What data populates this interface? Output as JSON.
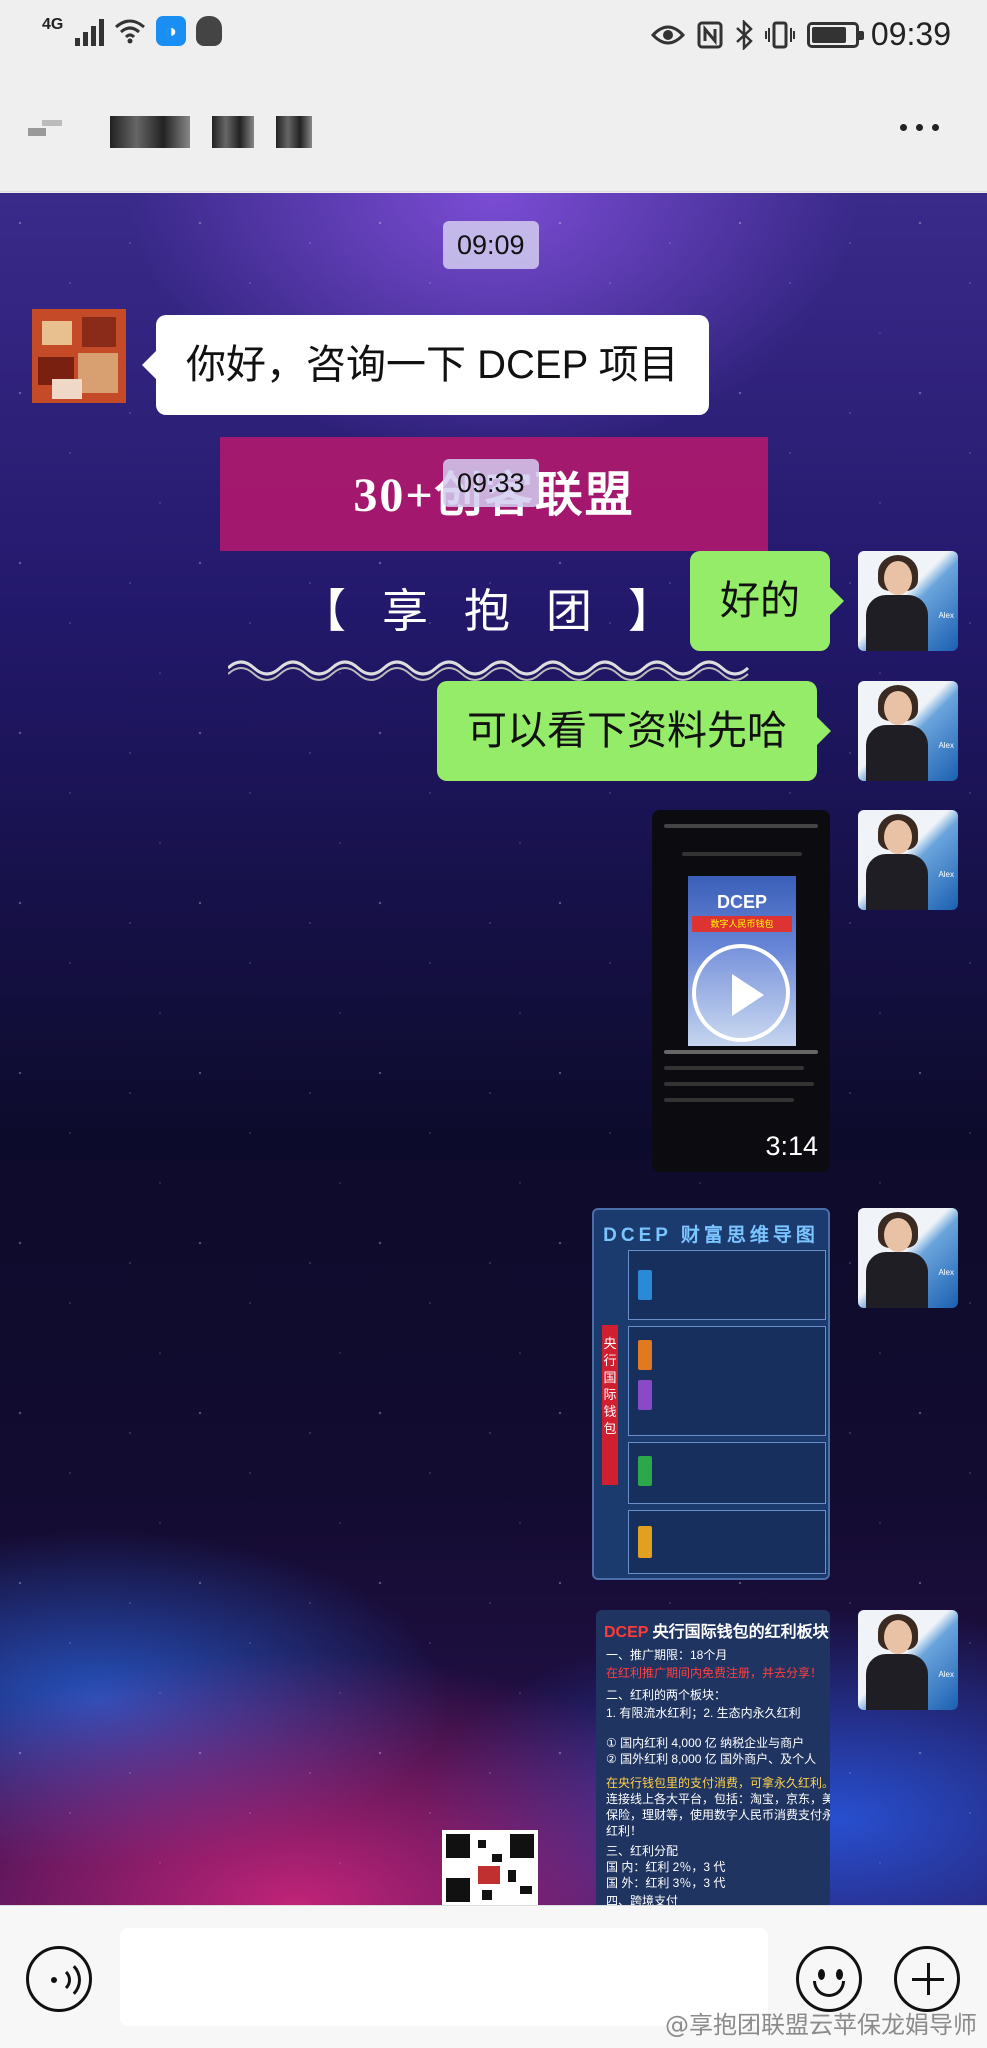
{
  "status_bar": {
    "network": "4G",
    "time": "09:39",
    "battery_level": 0.8,
    "icons": [
      "signal-icon",
      "wifi-icon",
      "blue-app-icon",
      "qq-penguin-icon",
      "eye-icon",
      "nfc-icon",
      "bluetooth-icon",
      "vibrate-icon",
      "battery-icon"
    ]
  },
  "header": {
    "more_icon": "more-dots-icon"
  },
  "chat": {
    "timestamps": [
      "09:09",
      "09:33"
    ],
    "background_banner": {
      "title": "30+创客联盟",
      "subtitle": "【享抱团】"
    },
    "messages": [
      {
        "from": "other",
        "type": "text",
        "text": "你好，咨询一下 DCEP 项目"
      },
      {
        "from": "me",
        "type": "text",
        "text": "好的"
      },
      {
        "from": "me",
        "type": "text",
        "text": "可以看下资料先哈"
      },
      {
        "from": "me",
        "type": "video",
        "duration": "3:14",
        "thumb_title": "DCEP",
        "thumb_subtitle": "数字人民币钱包"
      },
      {
        "from": "me",
        "type": "image",
        "image_title": "DCEP 财富思维导图",
        "spine_text": "央行国际钱包"
      },
      {
        "from": "me",
        "type": "image",
        "image_title": "央行国际钱包的红利板块",
        "lines": [
          "一、推广期限：18个月",
          "在红利推广期间内免费注册，并去分享！",
          "二、红利的两个板块：",
          "1. 有限流水红利；2. 生态内永久红利",
          "① 国内红利 4,000 亿 纳税企业与商户",
          "② 国外红利 8,000 亿 国外商户、及个人",
          "在央行钱包里的支付消费，可拿永久红利。",
          "连接线上各大平台，包括：淘宝，京东，美团，",
          "保险，理财等，使用数字人民币消费支付永享",
          "红利！",
          "三、红利分配",
          "国 内：红利 2％，3 代",
          "国 外：红利 3％，3 代",
          "四、跨境支付"
        ]
      }
    ]
  },
  "input_bar": {
    "placeholder": "",
    "voice_icon": "voice-icon",
    "emoji_icon": "emoji-icon",
    "plus_icon": "plus-icon"
  },
  "watermark": "@享抱团联盟云苹保龙娟导师",
  "colors": {
    "sent_bubble": "#95ec69",
    "received_bubble": "#ffffff",
    "app_bar": "#efefef"
  }
}
